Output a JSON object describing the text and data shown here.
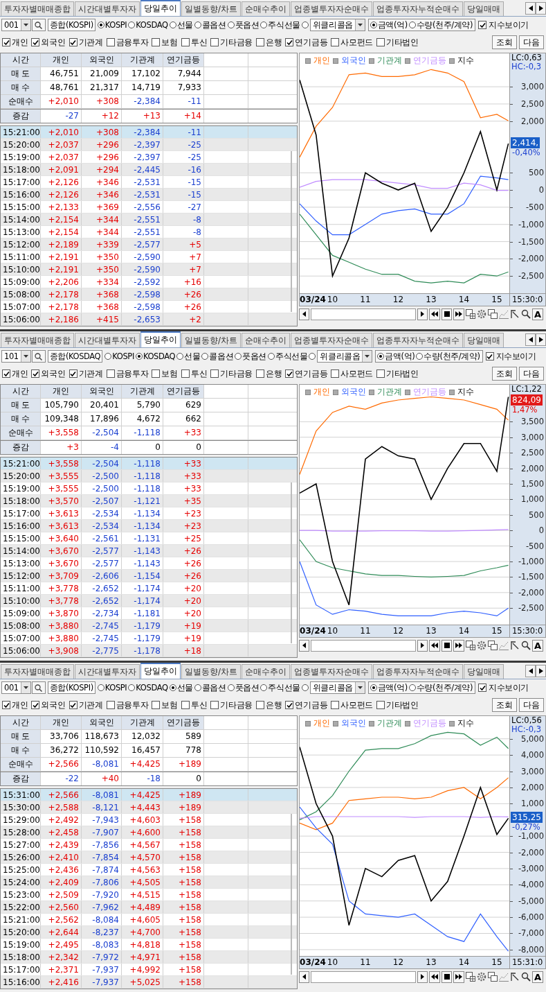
{
  "panels": [
    {
      "tabs": [
        {
          "label": "투자자별매매종합",
          "selected": false
        },
        {
          "label": "시간대별투자자",
          "selected": false
        },
        {
          "label": "당일추이",
          "selected": true
        },
        {
          "label": "일별동향/차트",
          "selected": false
        },
        {
          "label": "순매수추이",
          "selected": false
        },
        {
          "label": "업종별투자자순매수",
          "selected": false
        },
        {
          "label": "업종투자자누적순매수",
          "selected": false
        },
        {
          "label": "당일매매",
          "selected": false
        }
      ],
      "code": "001",
      "market": "종합(KOSPI)",
      "markets": [
        {
          "label": "KOSPI",
          "selected": true,
          "kind": "radio"
        },
        {
          "label": "KOSDAQ",
          "selected": false,
          "kind": "radio"
        },
        {
          "label": "선물",
          "selected": false,
          "kind": "radio"
        },
        {
          "label": "콜옵션",
          "selected": false,
          "kind": "radio"
        },
        {
          "label": "풋옵션",
          "selected": false,
          "kind": "radio"
        },
        {
          "label": "주식선물",
          "selected": false,
          "kind": "radio"
        },
        {
          "label": "위클리콜옵",
          "selected": false,
          "kind": "dropdown"
        }
      ],
      "units": [
        {
          "label": "금액(억)",
          "selected": true
        },
        {
          "label": "수량(천주/계약)",
          "selected": false
        }
      ],
      "show_index": {
        "label": "지수보이기",
        "checked": true
      },
      "investors": [
        {
          "label": "개인",
          "checked": true
        },
        {
          "label": "외국인",
          "checked": true
        },
        {
          "label": "기관계",
          "checked": true
        },
        {
          "label": "금융투자",
          "checked": false
        },
        {
          "label": "보험",
          "checked": false
        },
        {
          "label": "투신",
          "checked": false
        },
        {
          "label": "기타금융",
          "checked": false
        },
        {
          "label": "은행",
          "checked": false
        },
        {
          "label": "연기금등",
          "checked": true
        },
        {
          "label": "사모펀드",
          "checked": false
        },
        {
          "label": "기타법인",
          "checked": false
        }
      ],
      "buttons": [
        "조회",
        "다음"
      ],
      "summary": {
        "columns": [
          "시간",
          "개인",
          "외국인",
          "기관계",
          "연기금등"
        ],
        "rows": [
          {
            "label": "매 도",
            "values": [
              "46,751",
              "21,009",
              "17,102",
              "7,944"
            ]
          },
          {
            "label": "매 수",
            "values": [
              "48,761",
              "21,317",
              "14,719",
              "7,933"
            ]
          },
          {
            "label": "순매수",
            "values": [
              "+2,010",
              "+308",
              "-2,384",
              "-11"
            ]
          },
          {
            "label": "증감",
            "values": [
              "-27",
              "+12",
              "+13",
              "+14"
            ]
          }
        ]
      },
      "rows": [
        {
          "time": "15:21:00",
          "values": [
            "+2,010",
            "+308",
            "-2,384",
            "-11"
          ],
          "selected": true
        },
        {
          "time": "15:20:00",
          "values": [
            "+2,037",
            "+296",
            "-2,397",
            "-25"
          ],
          "selected": false
        },
        {
          "time": "15:19:00",
          "values": [
            "+2,037",
            "+296",
            "-2,397",
            "-25"
          ],
          "selected": false
        },
        {
          "time": "15:18:00",
          "values": [
            "+2,091",
            "+294",
            "-2,445",
            "-16"
          ],
          "selected": false
        },
        {
          "time": "15:17:00",
          "values": [
            "+2,126",
            "+346",
            "-2,531",
            "-15"
          ],
          "selected": false
        },
        {
          "time": "15:16:00",
          "values": [
            "+2,126",
            "+346",
            "-2,531",
            "-15"
          ],
          "selected": false
        },
        {
          "time": "15:15:00",
          "values": [
            "+2,133",
            "+369",
            "-2,556",
            "-27"
          ],
          "selected": false
        },
        {
          "time": "15:14:00",
          "values": [
            "+2,154",
            "+344",
            "-2,551",
            "-8"
          ],
          "selected": false
        },
        {
          "time": "15:13:00",
          "values": [
            "+2,154",
            "+344",
            "-2,551",
            "-8"
          ],
          "selected": false
        },
        {
          "time": "15:12:00",
          "values": [
            "+2,189",
            "+339",
            "-2,577",
            "+5"
          ],
          "selected": false
        },
        {
          "time": "15:11:00",
          "values": [
            "+2,191",
            "+350",
            "-2,590",
            "+7"
          ],
          "selected": false
        },
        {
          "time": "15:10:00",
          "values": [
            "+2,191",
            "+350",
            "-2,590",
            "+7"
          ],
          "selected": false
        },
        {
          "time": "15:09:00",
          "values": [
            "+2,206",
            "+334",
            "-2,592",
            "+16"
          ],
          "selected": false
        },
        {
          "time": "15:08:00",
          "values": [
            "+2,178",
            "+368",
            "-2,598",
            "+26"
          ],
          "selected": false
        },
        {
          "time": "15:07:00",
          "values": [
            "+2,178",
            "+368",
            "-2,598",
            "+26"
          ],
          "selected": false
        },
        {
          "time": "15:06:00",
          "values": [
            "+2,186",
            "+415",
            "-2,653",
            "+2"
          ],
          "selected": false
        }
      ],
      "chart": {
        "lc": "LC:0,63",
        "hc": "HC:-0,3",
        "price": "2,414,",
        "change": "-0,40%",
        "end_time": "15:30:0",
        "font_button": "A",
        "chart_data": {
          "type": "line",
          "x": [
            9,
            9.5,
            10,
            10.5,
            11,
            11.5,
            12,
            12.5,
            13,
            13.5,
            14,
            14.5,
            15,
            15.35
          ],
          "xlim": [
            9,
            15.4
          ],
          "ylim": [
            -3040,
            3970
          ],
          "grid": true,
          "xticks": [
            {
              "value": 9.4,
              "label": "03/24"
            },
            {
              "value": 10,
              "label": "10"
            },
            {
              "value": 11,
              "label": "11"
            },
            {
              "value": 12,
              "label": "12"
            },
            {
              "value": 13,
              "label": "13"
            },
            {
              "value": 14,
              "label": "14"
            },
            {
              "value": 15,
              "label": "15"
            }
          ],
          "yticks": [
            {
              "value": 3000,
              "label": "3,000"
            },
            {
              "value": 2500,
              "label": "2,500"
            },
            {
              "value": 2000,
              "label": "2,000"
            },
            500,
            0,
            -500,
            {
              "value": -1000,
              "label": "-1,000"
            },
            {
              "value": -1500,
              "label": "-1,500"
            },
            {
              "value": -2000,
              "label": "-2,000"
            },
            {
              "value": -2500,
              "label": "-2,500"
            }
          ],
          "series": [
            {
              "name": "개인",
              "color": "#ff6a00",
              "values": [
                950,
                1850,
                2400,
                3350,
                3400,
                3300,
                3300,
                3350,
                3500,
                3400,
                3150,
                2100,
                2200,
                2010
              ]
            },
            {
              "name": "외국인",
              "color": "#2f5fff",
              "values": [
                -400,
                -900,
                -1300,
                -1300,
                -1000,
                -700,
                -600,
                -550,
                -700,
                -700,
                -400,
                400,
                350,
                300
              ]
            },
            {
              "name": "기관계",
              "color": "#2e8b57",
              "values": [
                -700,
                -1300,
                -1900,
                -2100,
                -2300,
                -2450,
                -2450,
                -2650,
                -2700,
                -2650,
                -2700,
                -2450,
                -2500,
                -2380
              ]
            },
            {
              "name": "연기금등",
              "color": "#c08cff",
              "values": [
                80,
                250,
                300,
                300,
                300,
                250,
                200,
                150,
                50,
                50,
                200,
                150,
                -10,
                -10
              ]
            },
            {
              "name": "지수",
              "color": "#000000",
              "values": [
                3200,
                1600,
                -2500,
                -1400,
                500,
                200,
                0,
                200,
                -1200,
                -500,
                500,
                1700,
                0,
                1350
              ]
            }
          ]
        }
      }
    },
    {
      "tabs": [
        {
          "label": "투자자별매매종합",
          "selected": false
        },
        {
          "label": "시간대별투자자",
          "selected": false
        },
        {
          "label": "당일추이",
          "selected": true
        },
        {
          "label": "일별동향/차트",
          "selected": false
        },
        {
          "label": "순매수추이",
          "selected": false
        },
        {
          "label": "업종별투자자순매수",
          "selected": false
        },
        {
          "label": "업종투자자누적순매수",
          "selected": false
        },
        {
          "label": "당일매매",
          "selected": false
        }
      ],
      "code": "101",
      "market": "종합(KOSDAQ",
      "markets": [
        {
          "label": "KOSPI",
          "selected": false,
          "kind": "radio"
        },
        {
          "label": "KOSDAQ",
          "selected": true,
          "kind": "radio"
        },
        {
          "label": "선물",
          "selected": false,
          "kind": "radio"
        },
        {
          "label": "콜옵션",
          "selected": false,
          "kind": "radio"
        },
        {
          "label": "풋옵션",
          "selected": false,
          "kind": "radio"
        },
        {
          "label": "주식선물",
          "selected": false,
          "kind": "radio"
        },
        {
          "label": "위클리콜옵",
          "selected": false,
          "kind": "dropdown"
        }
      ],
      "units": [
        {
          "label": "금액(억)",
          "selected": true
        },
        {
          "label": "수량(천주/계약)",
          "selected": false
        }
      ],
      "show_index": {
        "label": "지수보이기",
        "checked": true
      },
      "investors": [
        {
          "label": "개인",
          "checked": true
        },
        {
          "label": "외국인",
          "checked": true
        },
        {
          "label": "기관계",
          "checked": true
        },
        {
          "label": "금융투자",
          "checked": false
        },
        {
          "label": "보험",
          "checked": false
        },
        {
          "label": "투신",
          "checked": false
        },
        {
          "label": "기타금융",
          "checked": false
        },
        {
          "label": "은행",
          "checked": false
        },
        {
          "label": "연기금등",
          "checked": true
        },
        {
          "label": "사모펀드",
          "checked": false
        },
        {
          "label": "기타법인",
          "checked": false
        }
      ],
      "buttons": [
        "조회",
        "다음"
      ],
      "summary": {
        "columns": [
          "시간",
          "개인",
          "외국인",
          "기관계",
          "연기금등"
        ],
        "rows": [
          {
            "label": "매 도",
            "values": [
              "105,790",
              "20,401",
              "5,790",
              "629"
            ]
          },
          {
            "label": "매 수",
            "values": [
              "109,348",
              "17,896",
              "4,672",
              "662"
            ]
          },
          {
            "label": "순매수",
            "values": [
              "+3,558",
              "-2,504",
              "-1,118",
              "+33"
            ]
          },
          {
            "label": "증감",
            "values": [
              "+3",
              "-4",
              "0",
              "0"
            ]
          }
        ]
      },
      "rows": [
        {
          "time": "15:21:00",
          "values": [
            "+3,558",
            "-2,504",
            "-1,118",
            "+33"
          ],
          "selected": true
        },
        {
          "time": "15:20:00",
          "values": [
            "+3,555",
            "-2,500",
            "-1,118",
            "+33"
          ],
          "selected": false
        },
        {
          "time": "15:19:00",
          "values": [
            "+3,555",
            "-2,500",
            "-1,118",
            "+33"
          ],
          "selected": false
        },
        {
          "time": "15:18:00",
          "values": [
            "+3,570",
            "-2,507",
            "-1,121",
            "+35"
          ],
          "selected": false
        },
        {
          "time": "15:17:00",
          "values": [
            "+3,613",
            "-2,534",
            "-1,134",
            "+23"
          ],
          "selected": false
        },
        {
          "time": "15:16:00",
          "values": [
            "+3,613",
            "-2,534",
            "-1,134",
            "+23"
          ],
          "selected": false
        },
        {
          "time": "15:15:00",
          "values": [
            "+3,640",
            "-2,561",
            "-1,131",
            "+25"
          ],
          "selected": false
        },
        {
          "time": "15:14:00",
          "values": [
            "+3,670",
            "-2,577",
            "-1,143",
            "+26"
          ],
          "selected": false
        },
        {
          "time": "15:13:00",
          "values": [
            "+3,670",
            "-2,577",
            "-1,143",
            "+26"
          ],
          "selected": false
        },
        {
          "time": "15:12:00",
          "values": [
            "+3,709",
            "-2,606",
            "-1,154",
            "+26"
          ],
          "selected": false
        },
        {
          "time": "15:11:00",
          "values": [
            "+3,778",
            "-2,652",
            "-1,174",
            "+20"
          ],
          "selected": false
        },
        {
          "time": "15:10:00",
          "values": [
            "+3,778",
            "-2,652",
            "-1,174",
            "+20"
          ],
          "selected": false
        },
        {
          "time": "15:09:00",
          "values": [
            "+3,870",
            "-2,734",
            "-1,181",
            "+20"
          ],
          "selected": false
        },
        {
          "time": "15:08:00",
          "values": [
            "+3,880",
            "-2,745",
            "-1,179",
            "+19"
          ],
          "selected": false
        },
        {
          "time": "15:07:00",
          "values": [
            "+3,880",
            "-2,745",
            "-1,179",
            "+19"
          ],
          "selected": false
        },
        {
          "time": "15:06:00",
          "values": [
            "+3,908",
            "-2,775",
            "-1,178",
            "+18"
          ],
          "selected": false
        }
      ],
      "chart": {
        "lc": "LC:1,22",
        "price": "824,09",
        "change": "1,47%",
        "end_time": "15:30:0",
        "font_button": "A",
        "chart_data": {
          "type": "line",
          "x": [
            9,
            9.5,
            10,
            10.5,
            11,
            11.5,
            12,
            12.5,
            13,
            13.5,
            14,
            14.5,
            15,
            15.35
          ],
          "xlim": [
            9,
            15.4
          ],
          "ylim": [
            -3075,
            4690
          ],
          "grid": true,
          "xticks": [
            {
              "value": 9.4,
              "label": "03/24"
            },
            {
              "value": 10,
              "label": "10"
            },
            {
              "value": 11,
              "label": "11"
            },
            {
              "value": 12,
              "label": "12"
            },
            {
              "value": 13,
              "label": "13"
            },
            {
              "value": 14,
              "label": "14"
            },
            {
              "value": 15,
              "label": "15"
            }
          ],
          "yticks": [
            {
              "value": 3500,
              "label": "3,500"
            },
            {
              "value": 3000,
              "label": "3,000"
            },
            {
              "value": 2500,
              "label": "2,500"
            },
            {
              "value": 2000,
              "label": "2,000"
            },
            {
              "value": 1500,
              "label": "1,500"
            },
            {
              "value": 1000,
              "label": "1,000"
            },
            500,
            0,
            -500,
            {
              "value": -1000,
              "label": "-1,000"
            },
            {
              "value": -1500,
              "label": "-1,500"
            },
            {
              "value": -2000,
              "label": "-2,000"
            },
            {
              "value": -2500,
              "label": "-2,500"
            }
          ],
          "series": [
            {
              "name": "개인",
              "color": "#ff6a00",
              "values": [
                1800,
                3200,
                3800,
                4000,
                3900,
                4100,
                4200,
                4250,
                4300,
                4250,
                4200,
                4050,
                3900,
                3550
              ]
            },
            {
              "name": "외국인",
              "color": "#2f5fff",
              "values": [
                -1000,
                -2400,
                -2700,
                -2550,
                -2600,
                -2700,
                -2750,
                -2750,
                -2750,
                -2650,
                -2600,
                -2650,
                -2750,
                -2500
              ]
            },
            {
              "name": "기관계",
              "color": "#2e8b57",
              "values": [
                -300,
                -1000,
                -1200,
                -1300,
                -1400,
                -1450,
                -1450,
                -1480,
                -1500,
                -1480,
                -1450,
                -1300,
                -1200,
                -1120
              ]
            },
            {
              "name": "연기금등",
              "color": "#c08cff",
              "values": [
                0,
                0,
                -20,
                -20,
                -20,
                -10,
                -10,
                -10,
                -20,
                -20,
                -10,
                0,
                20,
                30
              ]
            },
            {
              "name": "지수",
              "color": "#000000",
              "values": [
                1200,
                1500,
                -1000,
                -2400,
                2300,
                2700,
                2400,
                2300,
                1000,
                2000,
                2800,
                2800,
                1900,
                4300
              ]
            }
          ]
        }
      }
    },
    {
      "tabs": [
        {
          "label": "투자자별매매종합",
          "selected": false
        },
        {
          "label": "시간대별투자자",
          "selected": false
        },
        {
          "label": "당일추이",
          "selected": true
        },
        {
          "label": "일별동향/차트",
          "selected": false
        },
        {
          "label": "순매수추이",
          "selected": false
        },
        {
          "label": "업종별투자자순매수",
          "selected": false
        },
        {
          "label": "업종투자자누적순매수",
          "selected": false
        },
        {
          "label": "당일매매",
          "selected": false
        }
      ],
      "code": "001",
      "market": "종합(KOSPI)",
      "markets": [
        {
          "label": "KOSPI",
          "selected": false,
          "kind": "radio"
        },
        {
          "label": "KOSDAQ",
          "selected": false,
          "kind": "radio"
        },
        {
          "label": "선물",
          "selected": true,
          "kind": "radio"
        },
        {
          "label": "콜옵션",
          "selected": false,
          "kind": "radio"
        },
        {
          "label": "풋옵션",
          "selected": false,
          "kind": "radio"
        },
        {
          "label": "주식선물",
          "selected": false,
          "kind": "radio"
        },
        {
          "label": "위클리콜옵",
          "selected": false,
          "kind": "dropdown"
        }
      ],
      "units": [
        {
          "label": "금액(억)",
          "selected": true
        },
        {
          "label": "수량(천주/계약)",
          "selected": false
        }
      ],
      "show_index": {
        "label": "지수보이기",
        "checked": true
      },
      "investors": [
        {
          "label": "개인",
          "checked": true
        },
        {
          "label": "외국인",
          "checked": true
        },
        {
          "label": "기관계",
          "checked": true
        },
        {
          "label": "금융투자",
          "checked": false
        },
        {
          "label": "보험",
          "checked": false
        },
        {
          "label": "투신",
          "checked": false
        },
        {
          "label": "기타금융",
          "checked": false
        },
        {
          "label": "은행",
          "checked": false
        },
        {
          "label": "연기금등",
          "checked": true
        },
        {
          "label": "사모펀드",
          "checked": false
        },
        {
          "label": "기타법인",
          "checked": false
        }
      ],
      "buttons": [
        "조회",
        "다음"
      ],
      "summary": {
        "columns": [
          "시간",
          "개인",
          "외국인",
          "기관계",
          "연기금등"
        ],
        "rows": [
          {
            "label": "매 도",
            "values": [
              "33,706",
              "118,673",
              "12,032",
              "589"
            ]
          },
          {
            "label": "매 수",
            "values": [
              "36,272",
              "110,592",
              "16,457",
              "778"
            ]
          },
          {
            "label": "순매수",
            "values": [
              "+2,566",
              "-8,081",
              "+4,425",
              "+189"
            ]
          },
          {
            "label": "증감",
            "values": [
              "-22",
              "+40",
              "-18",
              "0"
            ]
          }
        ]
      },
      "rows": [
        {
          "time": "15:31:00",
          "values": [
            "+2,566",
            "-8,081",
            "+4,425",
            "+189"
          ],
          "selected": true
        },
        {
          "time": "15:30:00",
          "values": [
            "+2,588",
            "-8,121",
            "+4,443",
            "+189"
          ],
          "selected": false
        },
        {
          "time": "15:29:00",
          "values": [
            "+2,492",
            "-7,943",
            "+4,603",
            "+158"
          ],
          "selected": false
        },
        {
          "time": "15:28:00",
          "values": [
            "+2,458",
            "-7,907",
            "+4,600",
            "+158"
          ],
          "selected": false
        },
        {
          "time": "15:27:00",
          "values": [
            "+2,439",
            "-7,856",
            "+4,567",
            "+158"
          ],
          "selected": false
        },
        {
          "time": "15:26:00",
          "values": [
            "+2,410",
            "-7,854",
            "+4,570",
            "+158"
          ],
          "selected": false
        },
        {
          "time": "15:25:00",
          "values": [
            "+2,436",
            "-7,874",
            "+4,563",
            "+158"
          ],
          "selected": false
        },
        {
          "time": "15:24:00",
          "values": [
            "+2,409",
            "-7,806",
            "+4,505",
            "+158"
          ],
          "selected": false
        },
        {
          "time": "15:23:00",
          "values": [
            "+2,509",
            "-7,920",
            "+4,515",
            "+158"
          ],
          "selected": false
        },
        {
          "time": "15:22:00",
          "values": [
            "+2,560",
            "-7,962",
            "+4,489",
            "+158"
          ],
          "selected": false
        },
        {
          "time": "15:21:00",
          "values": [
            "+2,562",
            "-8,084",
            "+4,605",
            "+158"
          ],
          "selected": false
        },
        {
          "time": "15:20:00",
          "values": [
            "+2,644",
            "-8,237",
            "+4,700",
            "+158"
          ],
          "selected": false
        },
        {
          "time": "15:19:00",
          "values": [
            "+2,495",
            "-8,083",
            "+4,818",
            "+158"
          ],
          "selected": false
        },
        {
          "time": "15:18:00",
          "values": [
            "+2,342",
            "-7,972",
            "+4,971",
            "+158"
          ],
          "selected": false
        },
        {
          "time": "15:17:00",
          "values": [
            "+2,371",
            "-7,937",
            "+4,992",
            "+158"
          ],
          "selected": false
        },
        {
          "time": "15:16:00",
          "values": [
            "+2,416",
            "-7,937",
            "+5,025",
            "+158"
          ],
          "selected": false
        }
      ],
      "chart": {
        "lc": "LC:0,56",
        "hc": "HC:-0,3",
        "price": "315,25",
        "change": "-0,27%",
        "end_time": "15:31:0",
        "font_button": "A",
        "chart_data": {
          "type": "line",
          "x": [
            9,
            9.5,
            10,
            10.5,
            11,
            11.5,
            12,
            12.5,
            13,
            13.5,
            14,
            14.5,
            15,
            15.35
          ],
          "xlim": [
            9,
            15.4
          ],
          "ylim": [
            -8475,
            6400
          ],
          "grid": true,
          "xticks": [
            {
              "value": 9.4,
              "label": "03/24"
            },
            {
              "value": 10,
              "label": "10"
            },
            {
              "value": 11,
              "label": "11"
            },
            {
              "value": 12,
              "label": "12"
            },
            {
              "value": 13,
              "label": "13"
            },
            {
              "value": 14,
              "label": "14"
            },
            {
              "value": 15,
              "label": "15"
            }
          ],
          "yticks": [
            {
              "value": 5000,
              "label": "5,000"
            },
            {
              "value": 4000,
              "label": "4,000"
            },
            {
              "value": 3000,
              "label": "3,000"
            },
            {
              "value": 2000,
              "label": "2,000"
            },
            {
              "value": 1000,
              "label": "1,000"
            },
            {
              "value": -1000,
              "label": "-1,000"
            },
            {
              "value": -2000,
              "label": "-2,000"
            },
            {
              "value": -3000,
              "label": "-3,000"
            },
            {
              "value": -4000,
              "label": "-4,000"
            },
            {
              "value": -5000,
              "label": "-5,000"
            },
            {
              "value": -6000,
              "label": "-6,000"
            },
            {
              "value": -7000,
              "label": "-7,000"
            },
            {
              "value": -8000,
              "label": "-8,000"
            }
          ],
          "series": [
            {
              "name": "개인",
              "color": "#ff6a00",
              "values": [
                -200,
                -600,
                -200,
                1200,
                1300,
                1400,
                1400,
                1300,
                1400,
                1800,
                2000,
                1300,
                2000,
                2600
              ]
            },
            {
              "name": "외국인",
              "color": "#2f5fff",
              "values": [
                800,
                -500,
                -1500,
                -5000,
                -5800,
                -5900,
                -6000,
                -5800,
                -6500,
                -7200,
                -7500,
                -5800,
                -7200,
                -8100
              ]
            },
            {
              "name": "기관계",
              "color": "#2e8b57",
              "values": [
                0,
                500,
                1500,
                3000,
                4300,
                4400,
                4400,
                4700,
                5200,
                5400,
                5300,
                4600,
                5100,
                4400
              ]
            },
            {
              "name": "연기금등",
              "color": "#c08cff",
              "values": [
                100,
                200,
                200,
                200,
                200,
                200,
                200,
                150,
                200,
                200,
                200,
                150,
                200,
                190
              ]
            },
            {
              "name": "지수",
              "color": "#000000",
              "values": [
                4500,
                1000,
                -1000,
                -6500,
                -3000,
                -3500,
                -2500,
                -2200,
                -5000,
                -3800,
                -1000,
                2000,
                -900,
                100
              ]
            }
          ]
        }
      }
    }
  ]
}
